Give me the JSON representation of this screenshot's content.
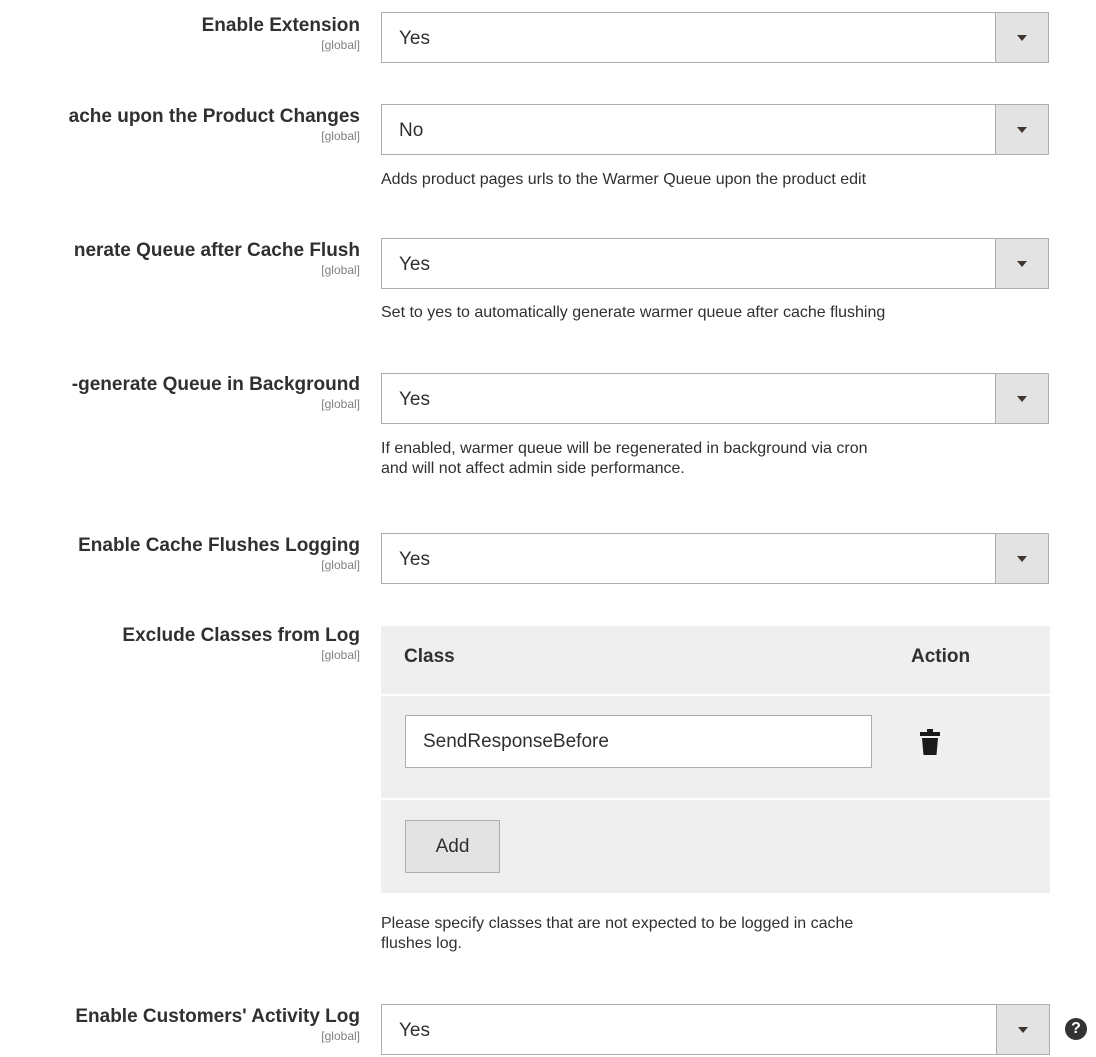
{
  "fields": [
    {
      "label": "Enable Extension",
      "scope": "[global]",
      "value": "Yes",
      "note": ""
    },
    {
      "label": "ache upon the Product Changes",
      "scope": "[global]",
      "value": "No",
      "note": "Adds product pages urls to the Warmer Queue upon the product edit"
    },
    {
      "label": "nerate Queue after Cache Flush",
      "scope": "[global]",
      "value": "Yes",
      "note": "Set to yes to automatically generate warmer queue after cache flushing"
    },
    {
      "label": "-generate Queue in Background",
      "scope": "[global]",
      "value": "Yes",
      "note": "If enabled, warmer queue will be regenerated in background via cron",
      "note2": "and will not affect admin side performance."
    },
    {
      "label": "Enable Cache Flushes Logging",
      "scope": "[global]",
      "value": "Yes"
    }
  ],
  "exclude": {
    "label": "Exclude Classes from Log",
    "scope": "[global]",
    "col_class": "Class",
    "col_action": "Action",
    "rows": [
      {
        "value": "SendResponseBefore"
      }
    ],
    "add_label": "Add",
    "note": "Please specify classes that are not expected to be logged in cache",
    "note2": "flushes log."
  },
  "activity": {
    "label": "Enable Customers' Activity Log",
    "scope": "[global]",
    "value": "Yes",
    "help_icon": "question-circle-icon"
  },
  "icons": {
    "dropdown": "chevron-down-icon",
    "delete": "trash-icon"
  },
  "colors": {
    "text": "#303030",
    "scope": "#808080",
    "border": "#adadad",
    "arrow_bg": "#e3e3e3",
    "grid_bg": "#efefef"
  }
}
